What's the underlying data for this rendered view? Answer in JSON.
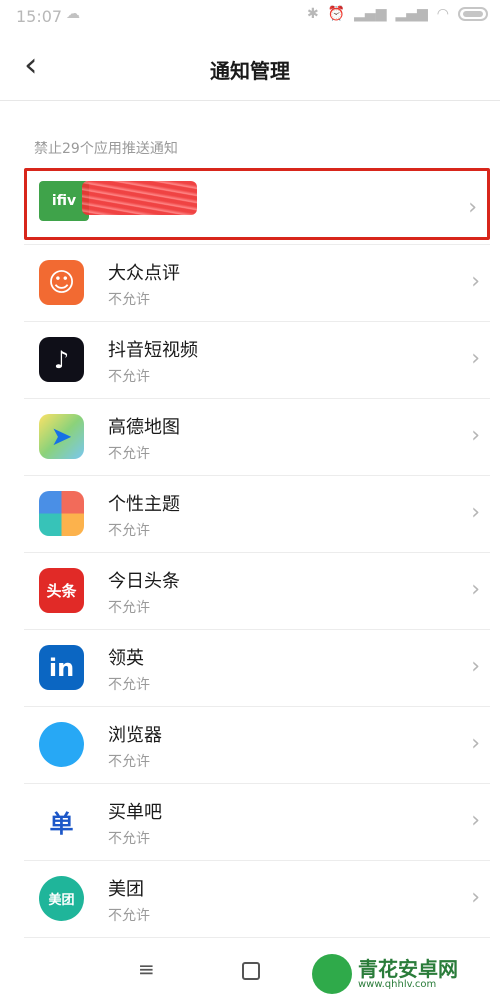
{
  "statusbar": {
    "time": "15:07"
  },
  "header": {
    "back_icon": "‹",
    "title": "通知管理"
  },
  "section_label": "禁止29个应用推送通知",
  "apps": [
    {
      "name": "",
      "status": "",
      "icon": "iqiyi-like-icon",
      "highlighted": true,
      "badge": "ifiv"
    },
    {
      "name": "大众点评",
      "status": "不允许",
      "icon": "dianping-icon",
      "color": "#f26a32",
      "glyph": "Ⓐ"
    },
    {
      "name": "抖音短视频",
      "status": "不允许",
      "icon": "douyin-icon",
      "color": "#0f0f18",
      "glyph": "♪"
    },
    {
      "name": "高德地图",
      "status": "不允许",
      "icon": "gaode-map-icon",
      "color": "#fff",
      "glyph": "➤"
    },
    {
      "name": "个性主题",
      "status": "不允许",
      "icon": "theme-icon",
      "color": "#fff",
      "glyph": "◆"
    },
    {
      "name": "今日头条",
      "status": "不允许",
      "icon": "toutiao-icon",
      "color": "#e12a27",
      "glyph": "头条"
    },
    {
      "name": "领英",
      "status": "不允许",
      "icon": "linkedin-icon",
      "color": "#0b66c2",
      "glyph": "in"
    },
    {
      "name": "浏览器",
      "status": "不允许",
      "icon": "browser-icon",
      "color": "#27a8f5",
      "glyph": "◯"
    },
    {
      "name": "买单吧",
      "status": "不允许",
      "icon": "maidanba-icon",
      "color": "#fff",
      "glyph": "单"
    },
    {
      "name": "美团",
      "status": "不允许",
      "icon": "meituan-icon",
      "color": "#1fb59a",
      "glyph": "美团"
    }
  ],
  "chevron": "›",
  "navbar": {
    "menu_icon": "≡"
  },
  "watermark": {
    "title": "青花安卓网",
    "url": "www.qhhlv.com"
  }
}
